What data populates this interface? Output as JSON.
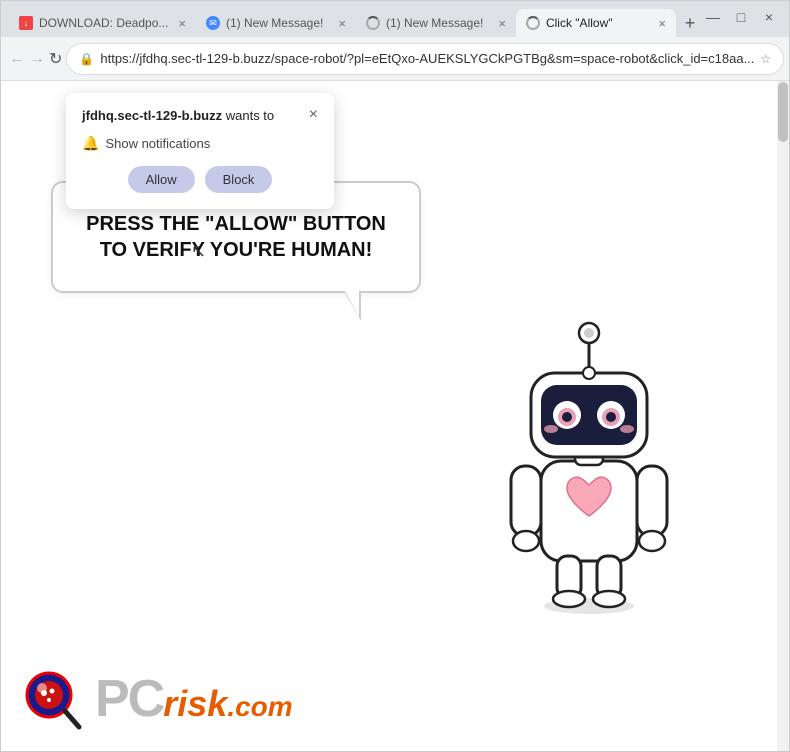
{
  "browser": {
    "tabs": [
      {
        "id": "tab1",
        "title": "DOWNLOAD: Deadpo...",
        "active": false,
        "favicon": "download"
      },
      {
        "id": "tab2",
        "title": "(1) New Message!",
        "active": false,
        "favicon": "msg"
      },
      {
        "id": "tab3",
        "title": "(1) New Message!",
        "active": false,
        "favicon": "spinner"
      },
      {
        "id": "tab4",
        "title": "Click \"Allow\"",
        "active": true,
        "favicon": "lock"
      }
    ],
    "new_tab_label": "+",
    "address": "https://jfdhq.sec-tl-129-b.buzz/space-robot/?pl=eEtQxo-AUEKSLYGCkPGTBg&sm=space-robot&click_id=c18aa...",
    "nav": {
      "back": "←",
      "forward": "→",
      "refresh": "↻",
      "home": ""
    }
  },
  "notification_popup": {
    "site": "jfdhq.sec-tl-129-b.buzz",
    "wants_text": " wants to",
    "close_btn": "×",
    "permission_text": "Show notifications",
    "allow_btn": "Allow",
    "block_btn": "Block"
  },
  "page": {
    "speech_bubble_text": "PRESS THE \"ALLOW\" BUTTON TO VERIFY YOU'RE HUMAN!",
    "logo_pc": "PC",
    "logo_risk": "risk",
    "logo_dot_com": ".com"
  }
}
